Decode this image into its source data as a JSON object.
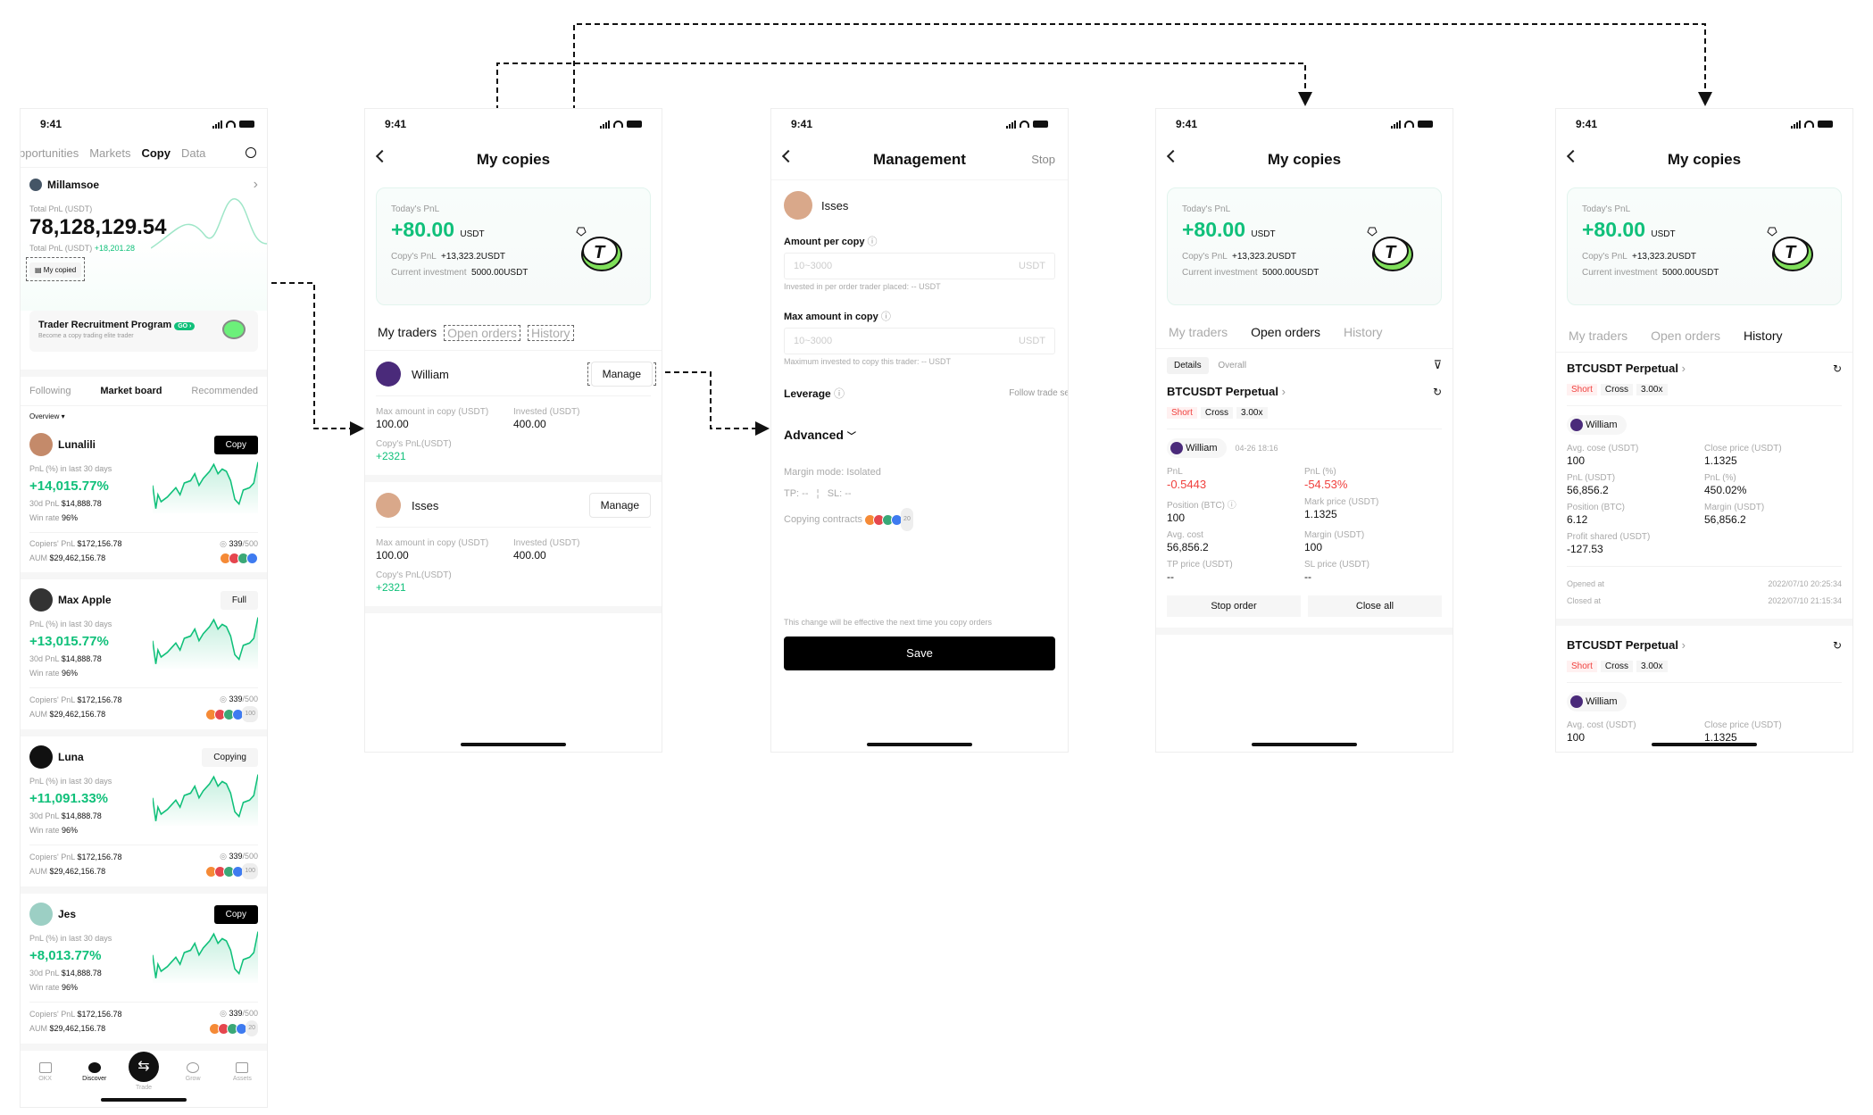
{
  "status_time": "9:41",
  "screen1": {
    "nav": [
      "pportunities",
      "Markets",
      "Copy",
      "Data"
    ],
    "active_nav": "Copy",
    "user": "Millamsoe",
    "total_pnl_label": "Total PnL (USDT)",
    "total_pnl": "78,128,129.54",
    "total_pnl_label2": "Total PnL (USDT)",
    "total_pnl_change": "+18,201.28",
    "my_copied": "My copied",
    "promo_title": "Trader Recruitment Program",
    "promo_badge": "GO ›",
    "promo_sub": "Become a copy trading elite trader",
    "tabs": [
      "Following",
      "Market board",
      "Recommended"
    ],
    "overview": "Overview ▾",
    "pnl_label": "PnL (%) in last 30 days",
    "pnl30_label": "30d PnL",
    "win_label": "Win rate",
    "copiers_label": "Copiers' PnL",
    "aum_label": "AUM",
    "traders": [
      {
        "name": "Lunalili",
        "action": "Copy",
        "pnl": "+14,015.77%",
        "pnl30": "$14,888.78",
        "win": "96%",
        "copiers": "$172,156.78",
        "aum": "$29,462,156.78",
        "slots": "339",
        "slots_max": "/500",
        "extra": ""
      },
      {
        "name": "Max Apple",
        "action": "Full",
        "pnl": "+13,015.77%",
        "pnl30": "$14,888.78",
        "win": "96%",
        "copiers": "$172,156.78",
        "aum": "$29,462,156.78",
        "slots": "339",
        "slots_max": "/500",
        "extra": "100"
      },
      {
        "name": "Luna",
        "action": "Copying",
        "pnl": "+11,091.33%",
        "pnl30": "$14,888.78",
        "win": "96%",
        "copiers": "$172,156.78",
        "aum": "$29,462,156.78",
        "slots": "339",
        "slots_max": "/500",
        "extra": "100"
      },
      {
        "name": "Jes",
        "action": "Copy",
        "pnl": "+8,013.77%",
        "pnl30": "$14,888.78",
        "win": "96%",
        "copiers": "$172,156.78",
        "aum": "$29,462,156.78",
        "slots": "339",
        "slots_max": "/500",
        "extra": "20"
      }
    ],
    "bottom_nav": [
      "OKX",
      "Discover",
      "Trade",
      "Grow",
      "Assets"
    ],
    "active_bottom": "Discover"
  },
  "copies": {
    "title": "My copies",
    "today_label": "Today's PnL",
    "today_value": "+80.00",
    "unit": "USDT",
    "copy_pnl_label": "Copy's PnL",
    "copy_pnl": "+13,323.2USDT",
    "investment_label": "Current investment",
    "investment": "5000.00USDT",
    "tabs": [
      "My traders",
      "Open orders",
      "History"
    ]
  },
  "screen2": {
    "manage": "Manage",
    "max_label": "Max amount in copy (USDT)",
    "invested_label": "Invested (USDT)",
    "cpnl_label": "Copy's PnL(USDT)",
    "traders": [
      {
        "name": "William",
        "max": "100.00",
        "invested": "400.00",
        "pnl": "+2321"
      },
      {
        "name": "Isses",
        "max": "100.00",
        "invested": "400.00",
        "pnl": "+2321"
      }
    ]
  },
  "screen3": {
    "title": "Management",
    "stop": "Stop",
    "trader": "Isses",
    "amount_label": "Amount per copy",
    "amount_placeholder": "10~3000",
    "amount_unit": "USDT",
    "amount_hint": "Invested in per order trader placed: -- USDT",
    "max_label": "Max amount in copy",
    "max_placeholder": "10~3000",
    "max_unit": "USDT",
    "max_hint": "Maximum invested to copy this trader: -- USDT",
    "leverage_label": "Leverage",
    "leverage_value": "Follow trade se",
    "advanced": "Advanced",
    "margin_mode": "Margin mode: Isolated",
    "tp": "TP: --",
    "sl": "SL: --",
    "contracts_label": "Copying contracts",
    "contracts_extra": "20",
    "notice": "This change will be effective the next time you copy orders",
    "save": "Save"
  },
  "screen4": {
    "subtabs": [
      "Details",
      "Overall"
    ],
    "symbol": "BTCUSDT Perpetual",
    "side": "Short",
    "mode": "Cross",
    "lev": "3.00x",
    "trader": "William",
    "time": "04-26 18:16",
    "fields": [
      {
        "label": "PnL",
        "value": "-0.5443",
        "neg": true
      },
      {
        "label": "PnL (%)",
        "value": "-54.53%",
        "neg": true
      },
      {
        "label": "Position (BTC) ⓘ",
        "value": "100"
      },
      {
        "label": "Mark price (USDT)",
        "value": "1.1325"
      },
      {
        "label": "Avg. cost",
        "value": "56,856.2"
      },
      {
        "label": "Margin (USDT)",
        "value": "100"
      },
      {
        "label": "TP price (USDT)",
        "value": "--"
      },
      {
        "label": "SL price (USDT)",
        "value": "--"
      }
    ],
    "stop_order": "Stop order",
    "close_all": "Close all"
  },
  "screen5": {
    "symbol": "BTCUSDT Perpetual",
    "side": "Short",
    "mode": "Cross",
    "lev": "3.00x",
    "trader": "William",
    "fields": [
      {
        "label": "Avg. cose (USDT)",
        "value": "100"
      },
      {
        "label": "Close price (USDT)",
        "value": "1.1325"
      },
      {
        "label": "PnL (USDT)",
        "value": "56,856.2"
      },
      {
        "label": "PnL (%)",
        "value": "450.02%"
      },
      {
        "label": "Position (BTC)",
        "value": "6.12"
      },
      {
        "label": "Margin (USDT)",
        "value": "56,856.2"
      },
      {
        "label": "Profit shared (USDT)",
        "value": "-127.53"
      }
    ],
    "opened_label": "Opened at",
    "opened": "2022/07/10 20:25:34",
    "closed_label": "Closed at",
    "closed": "2022/07/10 21:15:34",
    "second": {
      "symbol": "BTCUSDT Perpetual",
      "side": "Short",
      "mode": "Cross",
      "lev": "3.00x",
      "trader": "William",
      "fields": [
        {
          "label": "Avg. cost (USDT)",
          "value": "100"
        },
        {
          "label": "Close price (USDT)",
          "value": "1.1325"
        }
      ]
    }
  },
  "colors": {
    "green": "#10c07a",
    "red": "#f0413e",
    "accent": "#000000"
  }
}
